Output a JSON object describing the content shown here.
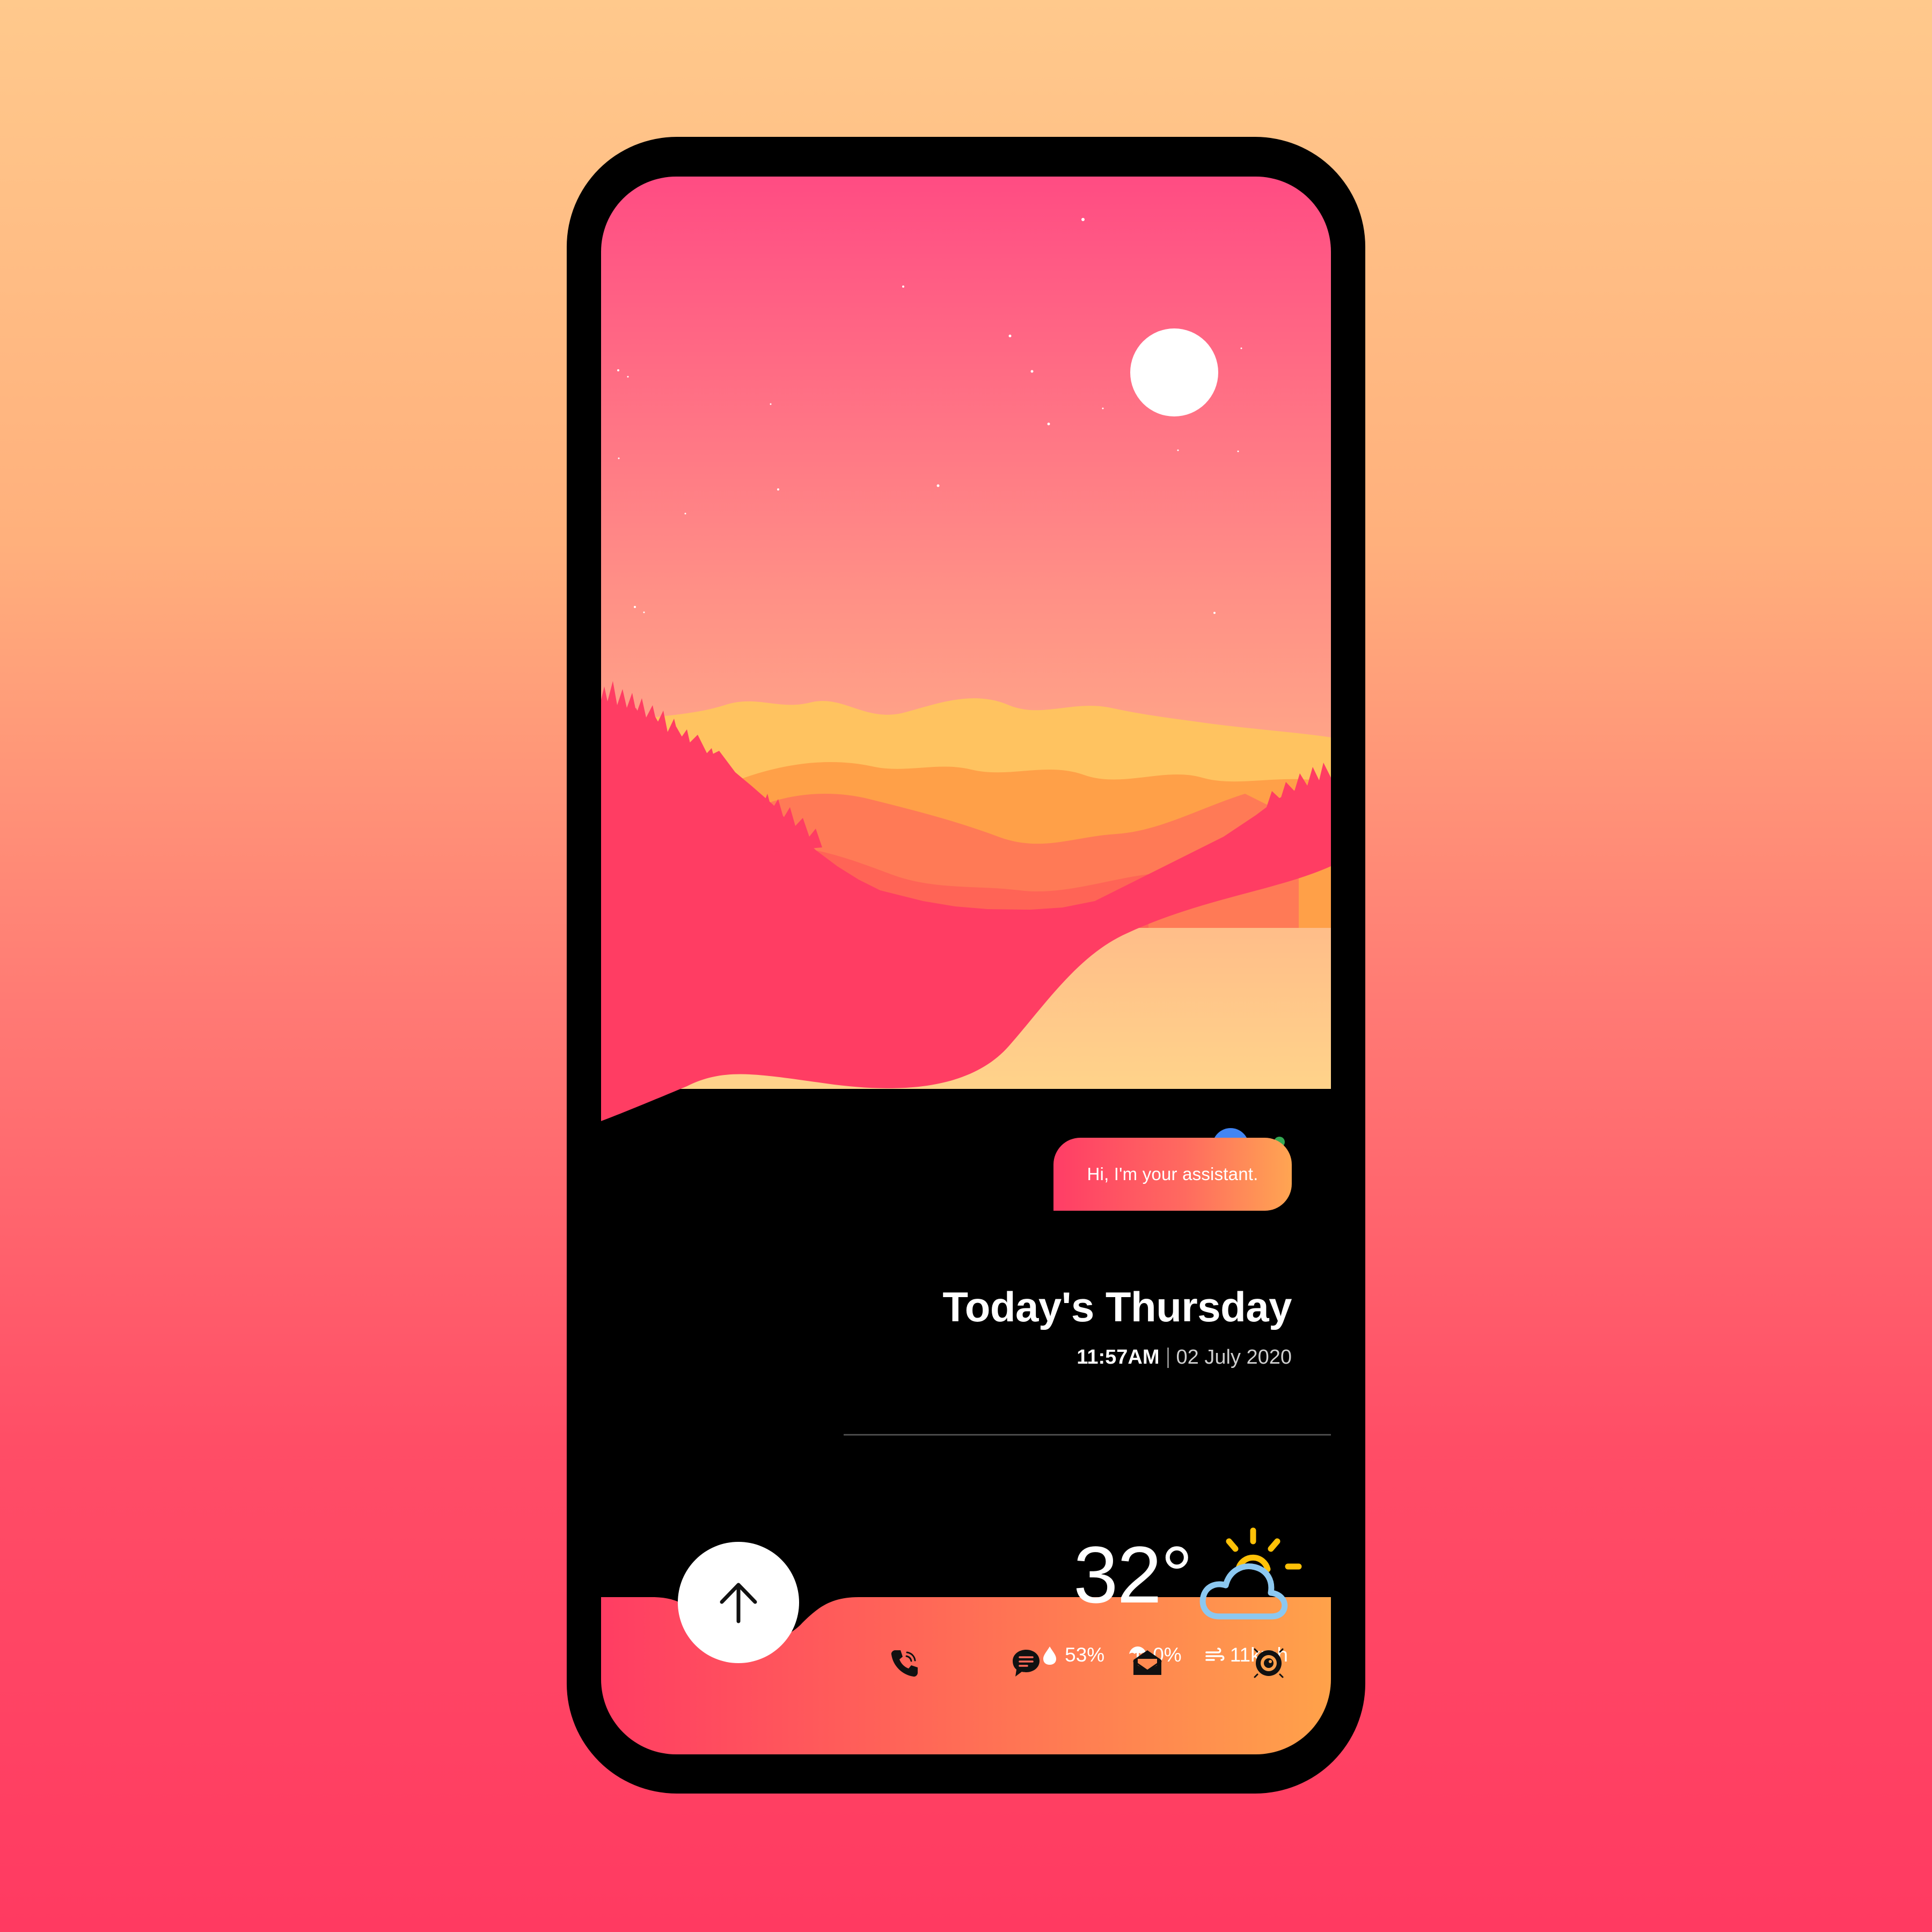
{
  "assistant": {
    "greeting": "Hi, I'm your assistant.",
    "colors": [
      "#4285F4",
      "#EA4335",
      "#FBBC05",
      "#34A853"
    ]
  },
  "header": {
    "day_title": "Today's Thursday",
    "time": "11:57AM",
    "date": "02 July 2020"
  },
  "weather": {
    "temperature": "32°",
    "condition_icon": "partly-cloudy-icon",
    "humidity": "53%",
    "precipitation": "0%",
    "wind": "11kmh"
  },
  "navbar": {
    "items": [
      {
        "icon": "phone-icon"
      },
      {
        "icon": "message-icon"
      },
      {
        "icon": "mail-icon"
      },
      {
        "icon": "camera-icon"
      }
    ]
  },
  "colors": {
    "accent_start": "#FF3D66",
    "accent_end": "#FFA552",
    "screen_bg": "#000000"
  }
}
